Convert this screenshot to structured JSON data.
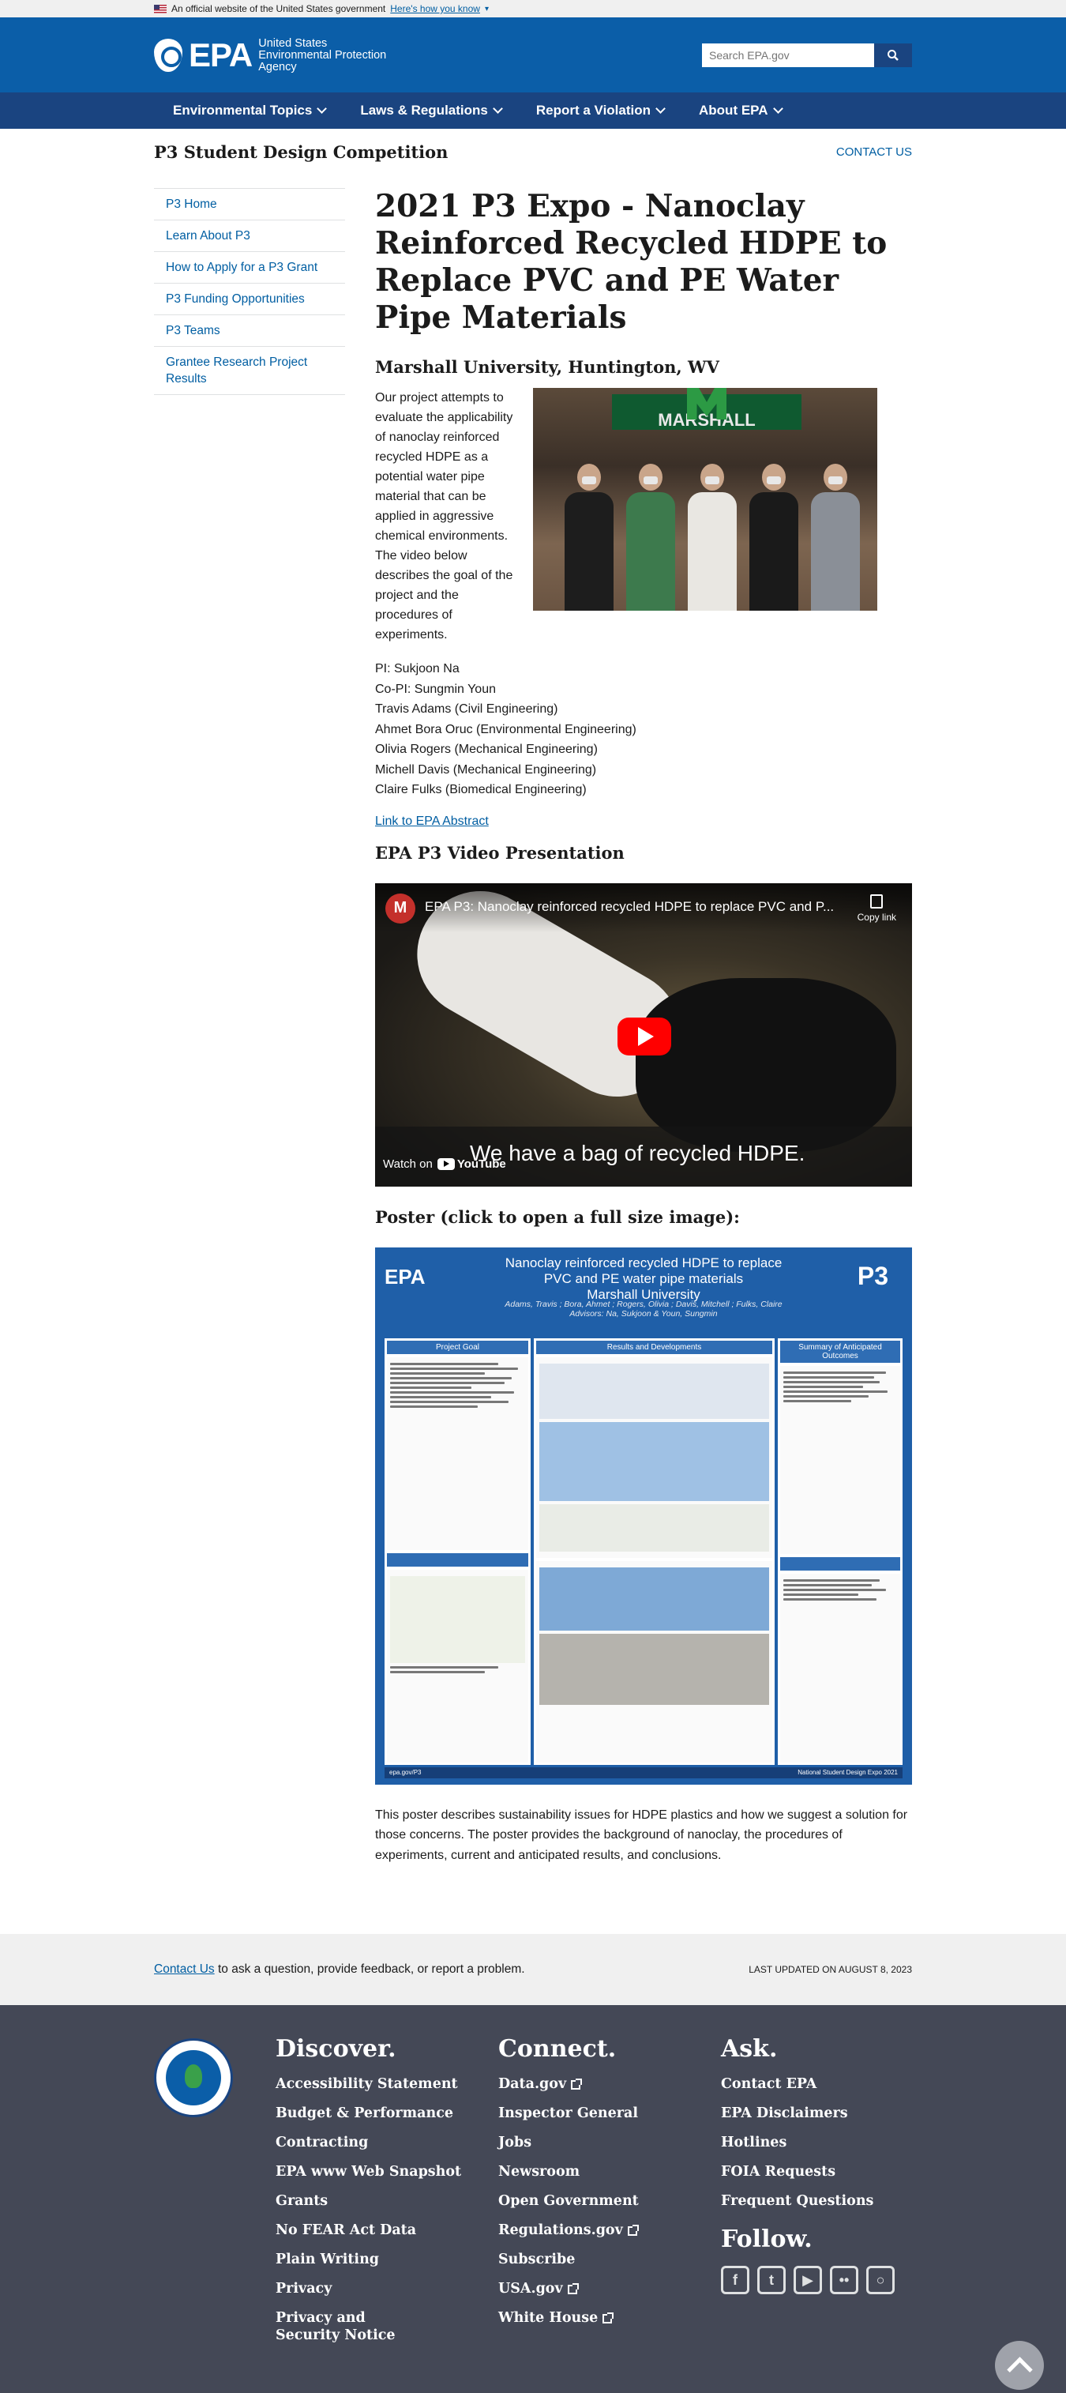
{
  "gov_banner": {
    "text": "An official website of the United States government",
    "link": "Here's how you know"
  },
  "header": {
    "logo": "EPA",
    "agency_lines": [
      "United States",
      "Environmental Protection",
      "Agency"
    ],
    "search_placeholder": "Search EPA.gov"
  },
  "nav": [
    "Environmental Topics",
    "Laws & Regulations",
    "Report a Violation",
    "About EPA"
  ],
  "site": {
    "title": "P3 Student Design Competition",
    "contact": "CONTACT US"
  },
  "sidebar": [
    "P3 Home",
    "Learn About P3",
    "How to Apply for a P3 Grant",
    "P3 Funding Opportunities",
    "P3 Teams",
    "Grantee Research Project Results"
  ],
  "main": {
    "title": "2021 P3 Expo - Nanoclay Reinforced Recycled HDPE to Replace PVC and PE Water Pipe Materials",
    "university": "Marshall University, Huntington, WV",
    "intro": "Our project attempts to evaluate the applicability of nanoclay reinforced recycled HDPE as a potential water pipe material that can be applied in aggressive chemical environments. The video below describes the goal of the project and the procedures of experiments.",
    "photo_banner": "MARSHALL",
    "people": [
      "PI: Sukjoon Na",
      "Co-PI: Sungmin Youn",
      "Travis Adams (Civil Engineering)",
      "Ahmet Bora Oruc (Environmental Engineering)",
      "Olivia Rogers (Mechanical Engineering)",
      "Michell Davis (Mechanical Engineering)",
      "Claire Fulks (Biomedical Engineering)"
    ],
    "abstract_link": "Link to EPA Abstract",
    "video_heading": "EPA P3 Video Presentation",
    "video": {
      "avatar": "M",
      "title": "EPA P3: Nanoclay reinforced recycled HDPE to replace PVC and P...",
      "copy_link": "Copy link",
      "caption": "We have a bag of recycled HDPE.",
      "watch_on": "Watch on",
      "youtube": "YouTube"
    },
    "poster_heading": "Poster (click to open a full size image):",
    "poster": {
      "title": "Nanoclay reinforced recycled HDPE to replace PVC and PE water pipe materials",
      "university": "Marshall University",
      "authors": "Adams, Travis ; Bora, Ahmet ; Rogers, Olivia ; Davis, Mitchell ; Fulks, Claire",
      "advisors": "Advisors: Na, Sukjoon & Youn, Sungmin",
      "epa": "EPA",
      "p3": "P3",
      "columns": [
        "Project Goal",
        "Results and Developments",
        "Summary of Anticipated Outcomes"
      ],
      "footer_left": "epa.gov/P3",
      "footer_right": "National Student Design Expo 2021"
    },
    "poster_description": "This poster describes sustainability issues for HDPE plastics and how we suggest a solution for those concerns. The poster provides the background of nanoclay, the procedures of experiments, current and anticipated results, and conclusions."
  },
  "contact_bar": {
    "link": "Contact Us",
    "text": " to ask a question, provide feedback, or report a problem.",
    "updated": "LAST UPDATED ON AUGUST 8, 2023"
  },
  "footer": {
    "discover": {
      "title": "Discover.",
      "links": [
        "Accessibility Statement",
        "Budget & Performance",
        "Contracting",
        "EPA www Web Snapshot",
        "Grants",
        "No FEAR Act Data",
        "Plain Writing",
        "Privacy",
        "Privacy and Security Notice"
      ]
    },
    "connect": {
      "title": "Connect.",
      "links": [
        "Data.gov",
        "Inspector General",
        "Jobs",
        "Newsroom",
        "Open Government",
        "Regulations.gov",
        "Subscribe",
        "USA.gov",
        "White House"
      ]
    },
    "ask": {
      "title": "Ask.",
      "links": [
        "Contact EPA",
        "EPA Disclaimers",
        "Hotlines",
        "FOIA Requests",
        "Frequent Questions"
      ]
    },
    "follow": "Follow."
  }
}
